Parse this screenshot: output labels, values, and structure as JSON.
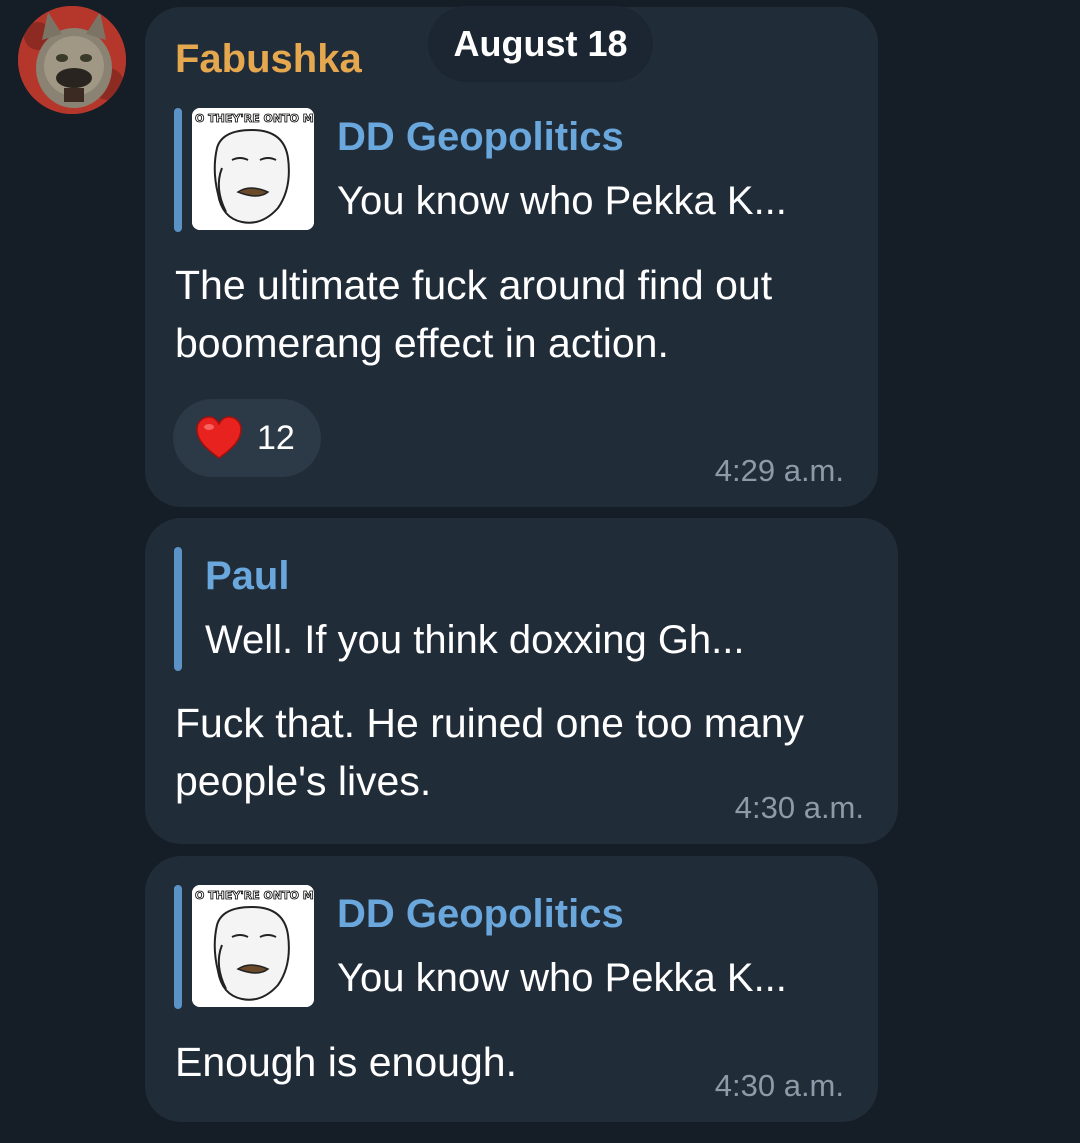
{
  "date_separator": "August 18",
  "colors": {
    "background": "#151e27",
    "bubble": "#212c39",
    "sender_name": "#e6a84e",
    "reply_name": "#6aa7dc",
    "reply_bar": "#5b93c6",
    "timestamp": "#8d9aa8",
    "reaction_pill": "#2c3947"
  },
  "messages": [
    {
      "sender": "Fabushka",
      "avatar_icon": "cat-avatar-icon",
      "reply": {
        "name": "DD Geopolitics",
        "preview": "You know who Pekka K...",
        "thumb_icon": "meme-face-thumbnail",
        "thumb_caption": "O THEY'RE ONTO ME!"
      },
      "text": "The ultimate fuck around find out\nboomerang effect in action.",
      "reaction": {
        "icon": "heart-icon",
        "count": "12"
      },
      "time": "4:29 a.m."
    },
    {
      "reply": {
        "name": "Paul",
        "preview": "Well. If you think doxxing Gh..."
      },
      "text": "Fuck that. He ruined one too many\npeople's lives.",
      "time": "4:30 a.m."
    },
    {
      "reply": {
        "name": "DD Geopolitics",
        "preview": "You know who Pekka K...",
        "thumb_icon": "meme-face-thumbnail",
        "thumb_caption": "O THEY'RE ONTO ME!"
      },
      "text": "Enough is enough.",
      "time": "4:30 a.m."
    }
  ]
}
